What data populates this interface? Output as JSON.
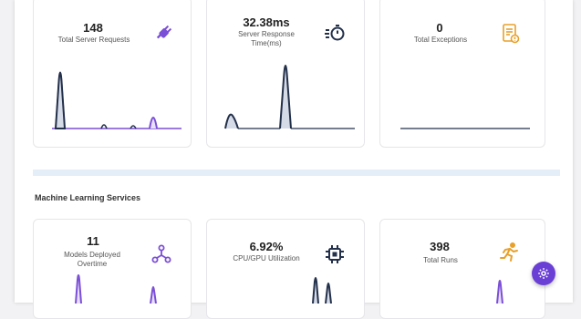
{
  "server_metrics": [
    {
      "value": "148",
      "label": "Total Server Requests",
      "icon": "plug-icon",
      "icon_color": "#7b4fd6"
    },
    {
      "value": "32.38ms",
      "label": "Server Response Time(ms)",
      "icon": "stopwatch-icon",
      "icon_color": "#23304a"
    },
    {
      "value": "0",
      "label": "Total Exceptions",
      "icon": "document-warning-icon",
      "icon_color": "#e8a02a"
    }
  ],
  "ml_section": {
    "title": "Machine Learning Services"
  },
  "ml_metrics": [
    {
      "value": "11",
      "label": "Models Deployed Overtime",
      "icon": "network-icon",
      "icon_color": "#7b4fd6"
    },
    {
      "value": "6.92%",
      "label": "CPU/GPU Utilization",
      "icon": "chip-icon",
      "icon_color": "#23304a"
    },
    {
      "value": "398",
      "label": "Total Runs",
      "icon": "runner-icon",
      "icon_color": "#e8a02a"
    }
  ],
  "fab": {
    "icon": "settings-gear-icon",
    "color": "#6a3fd6"
  },
  "colors": {
    "accent_purple": "#7b4fd6",
    "dark_navy": "#23304a",
    "orange": "#e8a02a",
    "divider": "#e3eef8"
  }
}
